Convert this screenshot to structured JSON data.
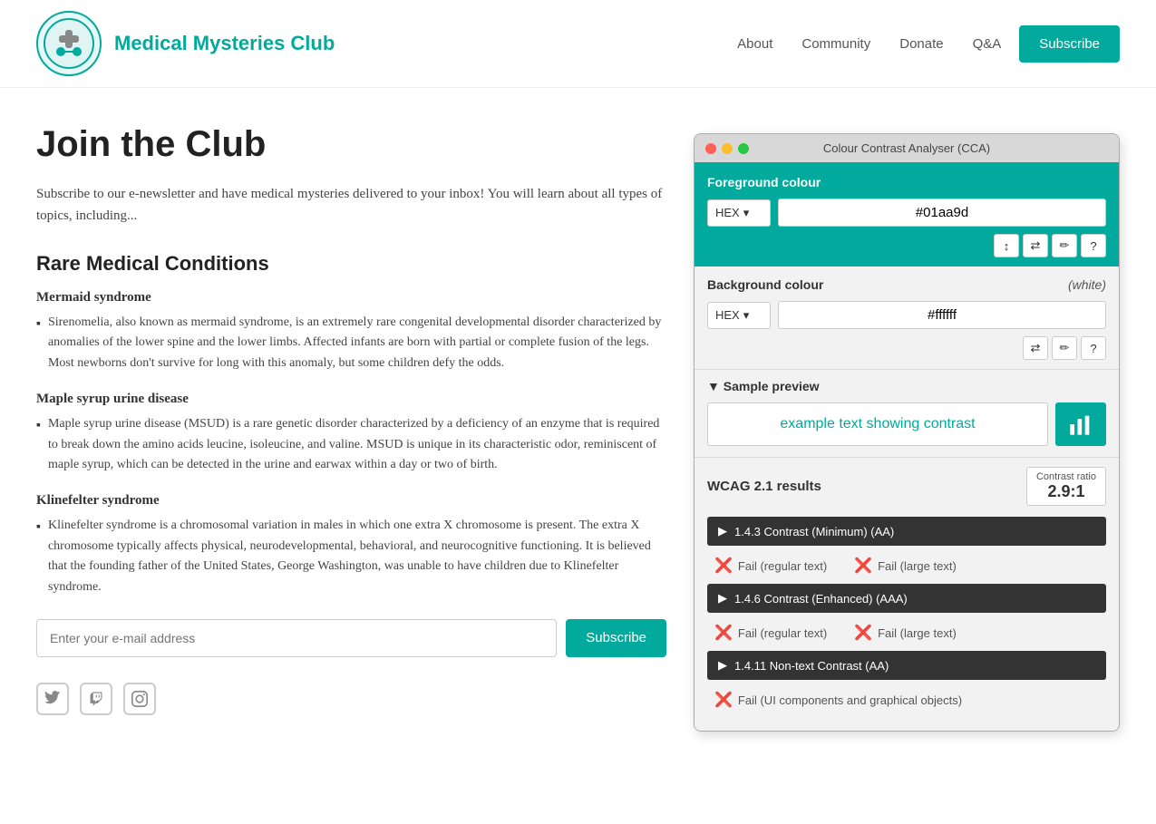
{
  "header": {
    "site_title": "Medical Mysteries Club",
    "nav": {
      "about": "About",
      "community": "Community",
      "donate": "Donate",
      "qa": "Q&A",
      "subscribe": "Subscribe"
    }
  },
  "main": {
    "page_heading": "Join the Club",
    "intro": "Subscribe to our e-newsletter and have medical mysteries delivered to your inbox! You will learn about all types of topics, including...",
    "rare_heading": "Rare Medical Conditions",
    "conditions": [
      {
        "name": "Mermaid syndrome",
        "description": "Sirenomelia, also known as mermaid syndrome, is an extremely rare congenital developmental disorder characterized by anomalies of the lower spine and the lower limbs. Affected infants are born with partial or complete fusion of the legs. Most newborns don't survive for long with this anomaly, but some children defy the odds."
      },
      {
        "name": "Maple syrup urine disease",
        "description": "Maple syrup urine disease (MSUD) is a rare genetic disorder characterized by a deficiency of an enzyme that is required to break down the amino acids leucine, isoleucine, and valine. MSUD is unique in its characteristic odor, reminiscent of maple syrup, which can be detected in the urine and earwax within a day or two of birth."
      },
      {
        "name": "Klinefelter syndrome",
        "description": "Klinefelter syndrome is a chromosomal variation in males in which one extra X chromosome is present. The extra X chromosome typically affects physical, neurodevelopmental, behavioral, and neurocognitive functioning. It is believed that the founding father of the United States, George Washington, was unable to have children due to Klinefelter syndrome."
      }
    ],
    "email_placeholder": "Enter your e-mail address",
    "subscribe_label": "Subscribe"
  },
  "cca": {
    "title": "Colour Contrast Analyser (CCA)",
    "foreground_label": "Foreground colour",
    "fg_format": "HEX",
    "fg_value": "#01aa9d",
    "fg_tools": [
      "↕",
      "⇄",
      "✏",
      "?"
    ],
    "background_label": "Background colour",
    "bg_white_label": "(white)",
    "bg_format": "HEX",
    "bg_value": "#ffffff",
    "bg_tools": [
      "⇄",
      "✏",
      "?"
    ],
    "preview_label": "▼ Sample preview",
    "preview_text": "example text showing contrast",
    "wcag_label": "WCAG 2.1 results",
    "contrast_ratio_label": "Contrast ratio",
    "contrast_ratio_value": "2.9:1",
    "criteria": [
      {
        "id": "1.4.3",
        "label": "1.4.3 Contrast (Minimum) (AA)",
        "results": [
          {
            "type": "Fail (regular text)"
          },
          {
            "type": "Fail (large text)"
          }
        ]
      },
      {
        "id": "1.4.6",
        "label": "1.4.6 Contrast (Enhanced) (AAA)",
        "results": [
          {
            "type": "Fail (regular text)"
          },
          {
            "type": "Fail (large text)"
          }
        ]
      },
      {
        "id": "1.4.11",
        "label": "1.4.11 Non-text Contrast (AA)",
        "results": [
          {
            "type": "Fail (UI components and graphical objects)"
          }
        ]
      }
    ]
  }
}
